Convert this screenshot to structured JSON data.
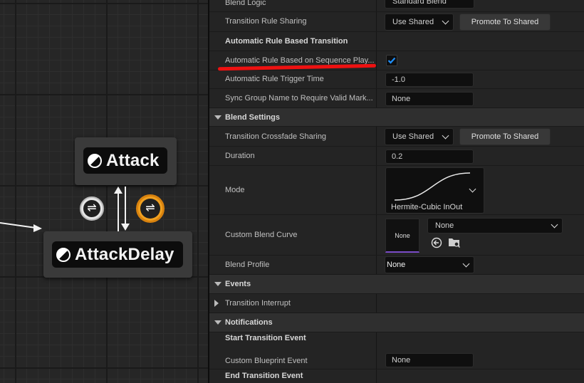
{
  "graph": {
    "node_attack": "Attack",
    "node_attack_delay": "AttackDelay",
    "colors": {
      "grid_bg": "#262626",
      "transition_active": "#f0a020"
    }
  },
  "details": {
    "blend_logic": {
      "label": "Blend Logic",
      "value": "Standard Blend"
    },
    "transition_rule_sharing": {
      "label": "Transition Rule Sharing",
      "value": "Use Shared",
      "button": "Promote To Shared"
    },
    "auto_rule_header": "Automatic Rule Based Transition",
    "auto_rule_seq": {
      "label": "Automatic Rule Based on Sequence Play...",
      "checked": true
    },
    "auto_rule_trigger": {
      "label": "Automatic Rule Trigger Time",
      "value": "-1.0"
    },
    "sync_group": {
      "label": "Sync Group Name to Require Valid Mark...",
      "value": "None"
    },
    "blend_settings": {
      "header": "Blend Settings",
      "crossfade": {
        "label": "Transition Crossfade Sharing",
        "value": "Use Shared",
        "button": "Promote To Shared"
      },
      "duration": {
        "label": "Duration",
        "value": "0.2"
      },
      "mode": {
        "label": "Mode",
        "value": "Hermite-Cubic InOut"
      },
      "custom_curve": {
        "label": "Custom Blend Curve",
        "thumb": "None",
        "value": "None"
      },
      "blend_profile": {
        "label": "Blend Profile",
        "value": "None"
      }
    },
    "events": {
      "header": "Events",
      "transition_interrupt": "Transition Interrupt"
    },
    "notifications": {
      "header": "Notifications",
      "start_event": "Start Transition Event",
      "custom_bp_event": {
        "label": "Custom Blueprint Event",
        "value": "None"
      },
      "end_event": "End Transition Event"
    }
  },
  "annotation": {
    "color": "#e11111"
  }
}
